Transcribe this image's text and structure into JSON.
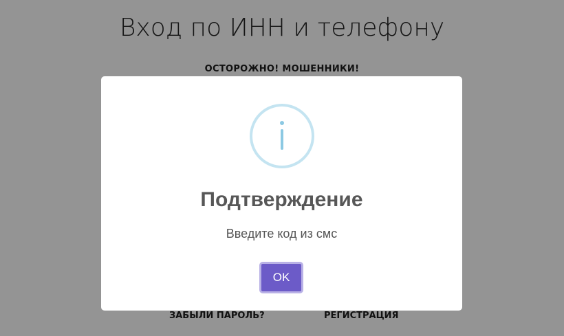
{
  "page": {
    "title": "Вход по ИНН и телефону",
    "warning": "ОСТОРОЖНО! МОШЕННИКИ!",
    "forgot_password": "ЗАБЫЛИ ПАРОЛЬ?",
    "register": "РЕГИСТРАЦИЯ"
  },
  "modal": {
    "icon": "info-icon",
    "title": "Подтверждение",
    "text": "Введите код из смс",
    "ok_label": "OK"
  },
  "colors": {
    "overlay": "#949494",
    "ok_button": "#6c5bc8",
    "icon": "#8cc9e3"
  }
}
